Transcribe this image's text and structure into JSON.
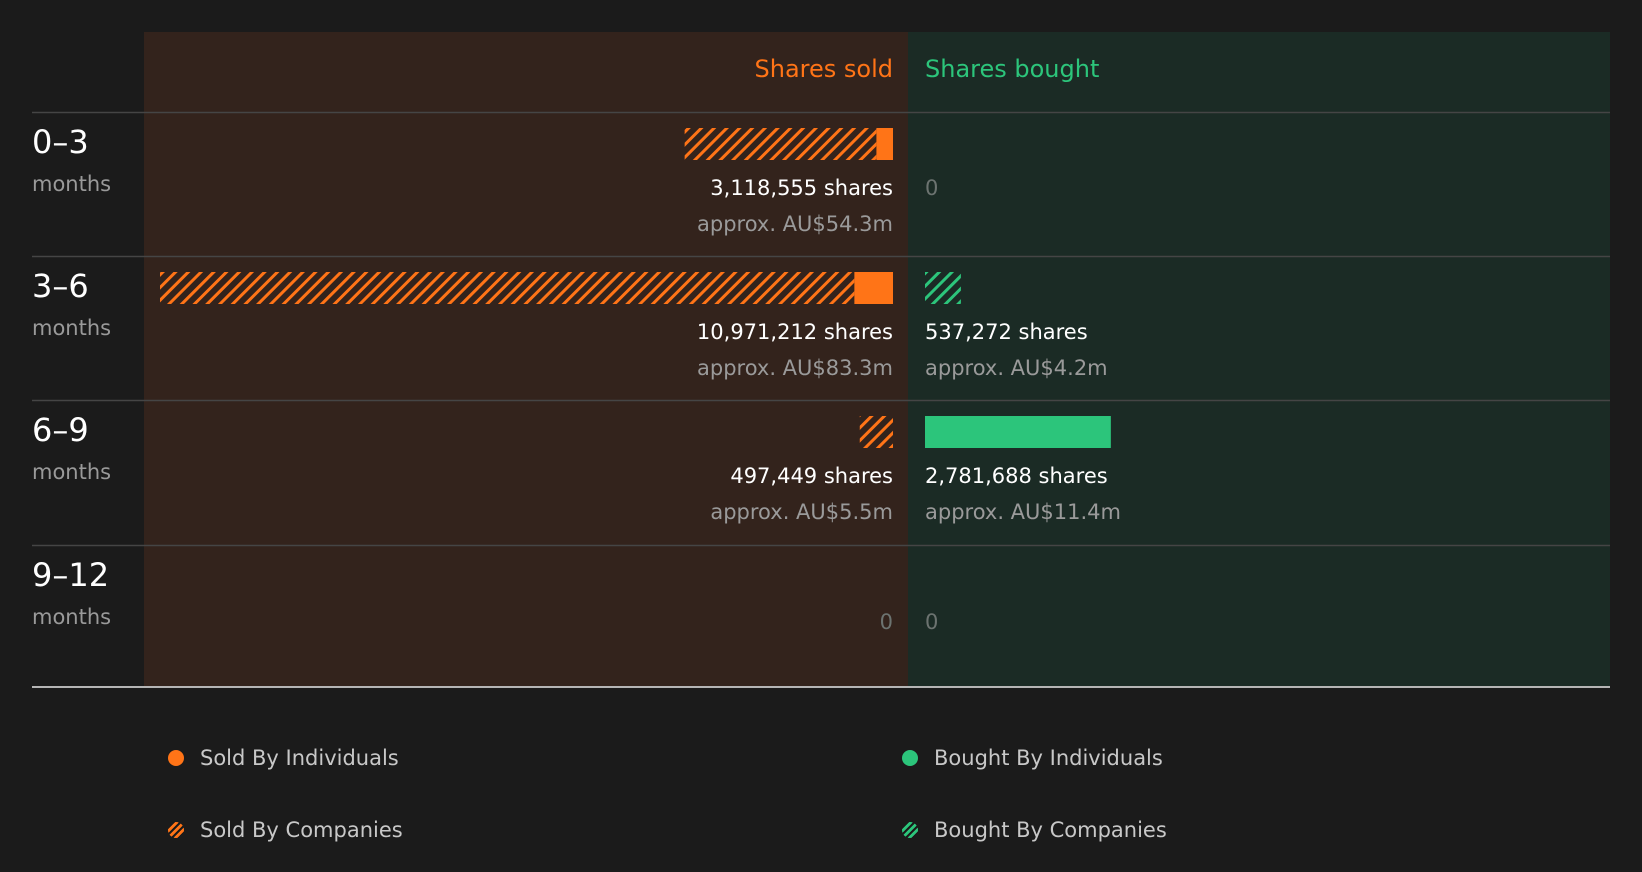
{
  "chart_data": {
    "type": "bar",
    "headers": {
      "sold": "Shares sold",
      "bought": "Shares bought"
    },
    "categories": [
      {
        "period": "0–3",
        "unit": "months"
      },
      {
        "period": "3–6",
        "unit": "months"
      },
      {
        "period": "6–9",
        "unit": "months"
      },
      {
        "period": "9–12",
        "unit": "months"
      }
    ],
    "sold": [
      {
        "individuals": 250000,
        "companies": 2868555,
        "shares_label": "3,118,555 shares",
        "value_label": "approx. AU$54.3m"
      },
      {
        "individuals": 580000,
        "companies": 10391212,
        "shares_label": "10,971,212 shares",
        "value_label": "approx. AU$83.3m"
      },
      {
        "individuals": 0,
        "companies": 497449,
        "shares_label": "497,449 shares",
        "value_label": "approx. AU$5.5m"
      },
      {
        "individuals": 0,
        "companies": 0,
        "shares_label": "0",
        "value_label": ""
      }
    ],
    "bought": [
      {
        "individuals": 0,
        "companies": 0,
        "shares_label": "0",
        "value_label": ""
      },
      {
        "individuals": 0,
        "companies": 537272,
        "shares_label": "537,272 shares",
        "value_label": "approx. AU$4.2m"
      },
      {
        "individuals": 2781688,
        "companies": 0,
        "shares_label": "2,781,688 shares",
        "value_label": "approx. AU$11.4m"
      },
      {
        "individuals": 0,
        "companies": 0,
        "shares_label": "0",
        "value_label": ""
      }
    ],
    "legend": [
      {
        "label": "Sold By Individuals",
        "color": "#ff7417",
        "pattern": "solid"
      },
      {
        "label": "Bought By Individuals",
        "color": "#2cc57b",
        "pattern": "solid"
      },
      {
        "label": "Sold By Companies",
        "color": "#ff7417",
        "pattern": "hatched"
      },
      {
        "label": "Bought By Companies",
        "color": "#2cc57b",
        "pattern": "hatched"
      }
    ],
    "colors": {
      "sold": "#ff7417",
      "bought": "#2cc57b",
      "sold_panel": "#33231c",
      "bought_panel": "#1b2b25",
      "background": "#1b1b1b"
    }
  }
}
